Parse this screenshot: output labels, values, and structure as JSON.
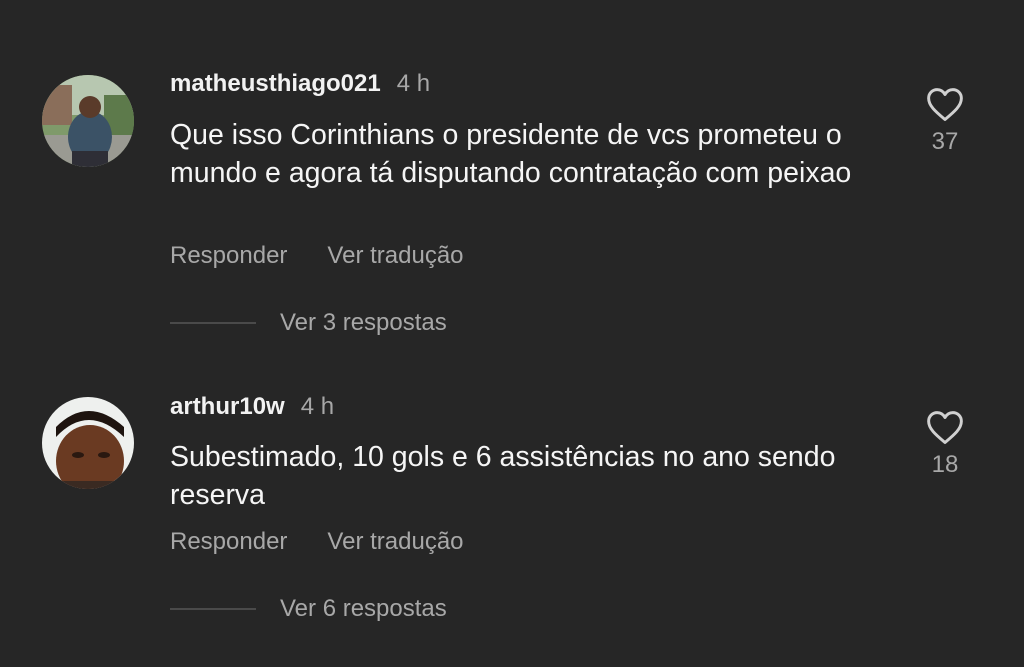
{
  "comments": [
    {
      "username": "matheusthiago021",
      "time": "4 h",
      "text": "Que isso Corinthians o presidente de vcs prometeu o mundo e agora tá disputando contratação com peixao",
      "reply_label": "Responder",
      "translate_label": "Ver tradução",
      "view_replies": "Ver 3 respostas",
      "likes": "37",
      "avatar": "user-avatar-photo"
    },
    {
      "username": "arthur10w",
      "time": "4 h",
      "text": "Subestimado, 10 gols e 6 assistências no ano sendo reserva",
      "reply_label": "Responder",
      "translate_label": "Ver tradução",
      "view_replies": "Ver 6 respostas",
      "likes": "18",
      "avatar": "user-avatar-photo"
    }
  ],
  "icons": {
    "like": "heart-outline-icon"
  },
  "colors": {
    "background": "#262626",
    "primary_text": "#f5f5f5",
    "secondary_text": "#a8a8a8"
  }
}
